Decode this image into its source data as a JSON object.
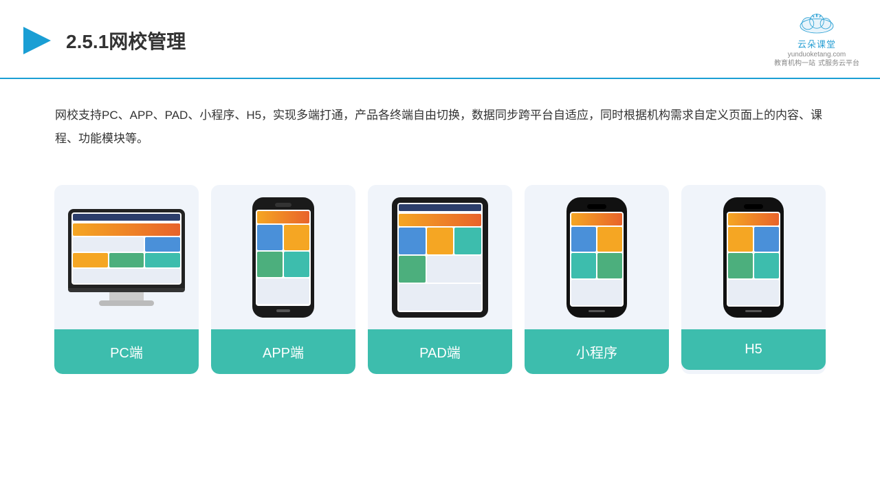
{
  "header": {
    "title": "2.5.1网校管理",
    "logo_brand": "云朵课堂",
    "logo_url": "yunduoketang.com",
    "logo_tagline_line1": "教育机构一站",
    "logo_tagline_line2": "式服务云平台"
  },
  "description": {
    "text": "网校支持PC、APP、PAD、小程序、H5，实现多端打通，产品各终端自由切换，数据同步跨平台自适应，同时根据机构需求自定义页面上的内容、课程、功能模块等。"
  },
  "cards": [
    {
      "id": "pc",
      "label": "PC端"
    },
    {
      "id": "app",
      "label": "APP端"
    },
    {
      "id": "pad",
      "label": "PAD端"
    },
    {
      "id": "miniprogram",
      "label": "小程序"
    },
    {
      "id": "h5",
      "label": "H5"
    }
  ],
  "colors": {
    "accent": "#3dbdad",
    "header_line": "#1a9ed4"
  }
}
